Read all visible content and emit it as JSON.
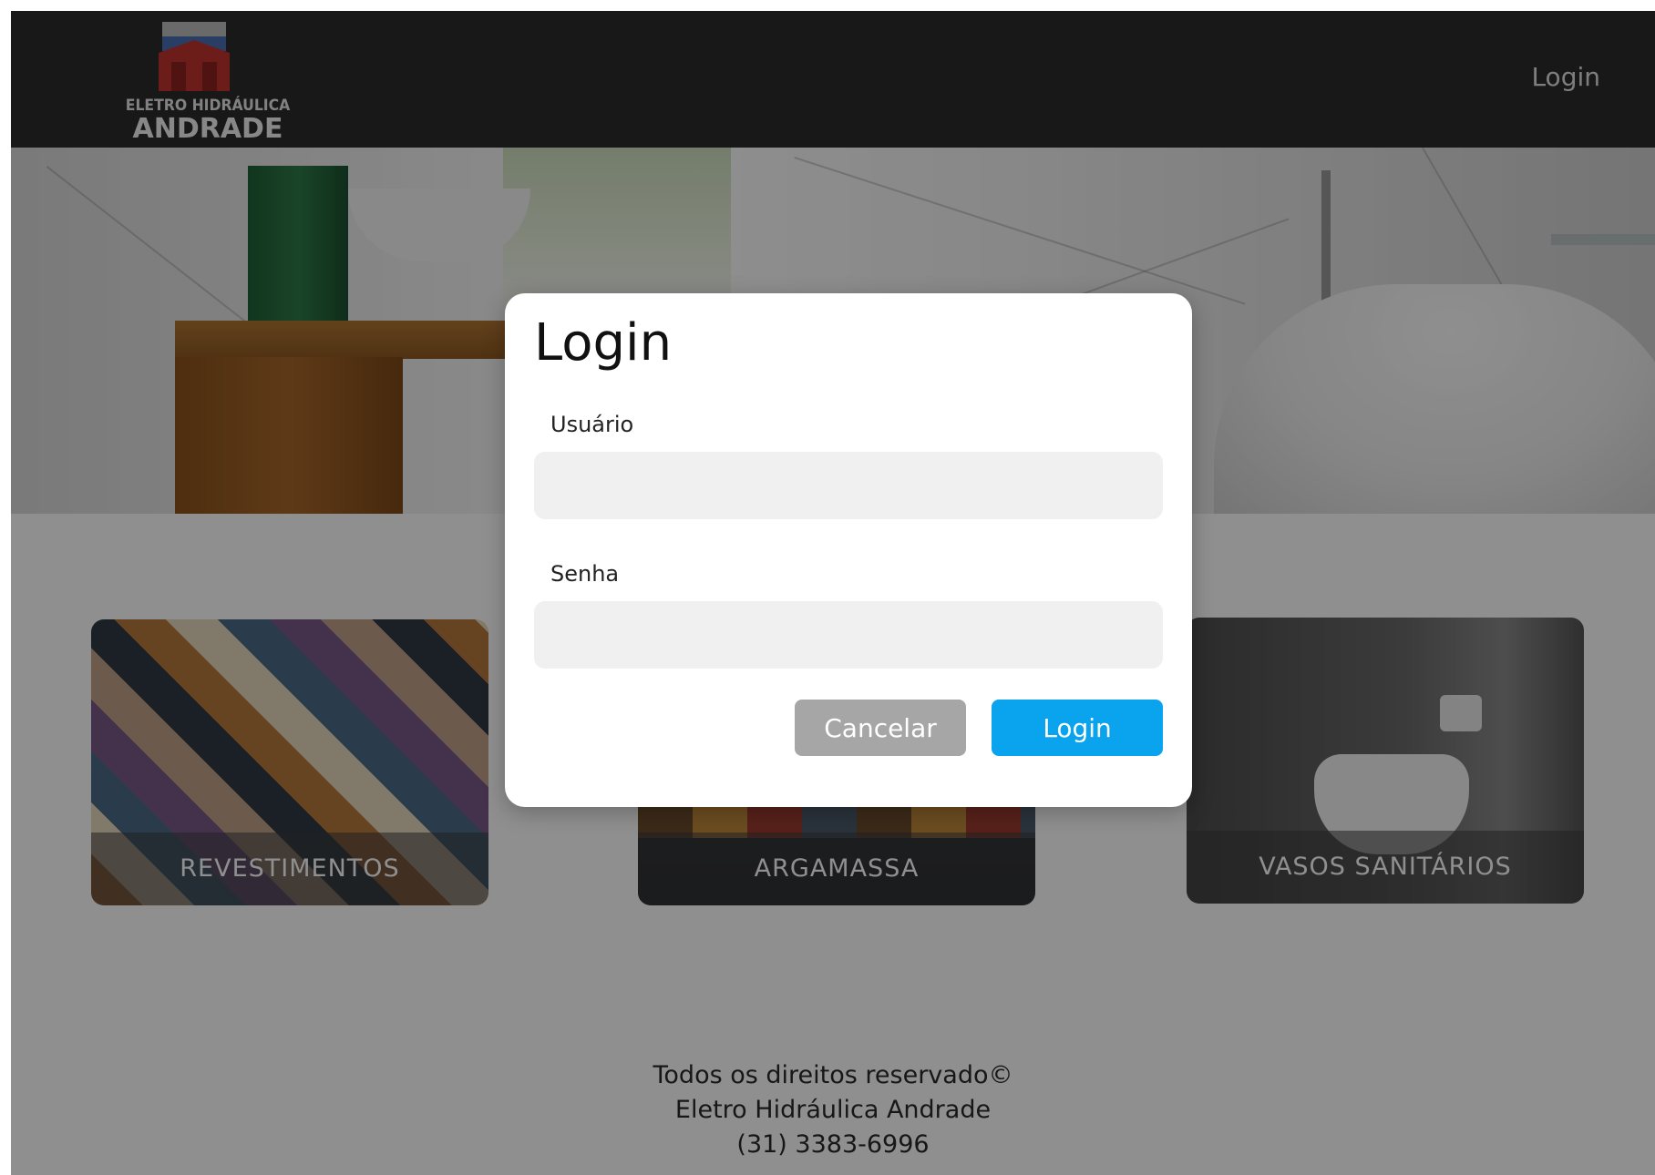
{
  "header": {
    "logo_line1": "ELETRO HIDRÁULICA",
    "logo_line2": "ANDRADE",
    "nav_login": "Login"
  },
  "categories": [
    {
      "label": "REVESTIMENTOS"
    },
    {
      "label": "ARGAMASSA"
    },
    {
      "label": "VASOS SANITÁRIOS"
    }
  ],
  "footer": {
    "line1": "Todos os direitos reservado©",
    "line2": "Eletro Hidráulica Andrade",
    "line3": "(31) 3383-6996"
  },
  "modal": {
    "title": "Login",
    "username_label": "Usuário",
    "username_value": "",
    "password_label": "Senha",
    "password_value": "",
    "cancel_label": "Cancelar",
    "login_label": "Login"
  },
  "colors": {
    "header_bg": "#2b2b2b",
    "primary_button": "#0aa3ee",
    "secondary_button": "#a6a6a6",
    "input_bg": "#f0f0f0"
  }
}
